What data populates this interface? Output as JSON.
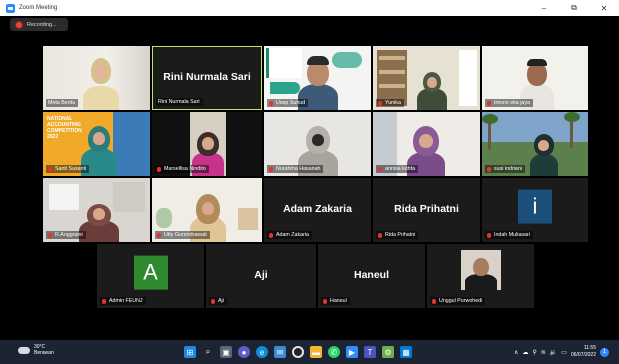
{
  "window": {
    "title": "Zoom Meeting",
    "minimize": "–",
    "restore": "⧉",
    "close": "✕"
  },
  "recording": {
    "label": "Recording..."
  },
  "participants": [
    {
      "name": "Meta Berdu",
      "video": true
    },
    {
      "name": "Rini Nurmala Sari",
      "video": false,
      "active": true
    },
    {
      "name": "Usep Suhud",
      "video": true,
      "muted": true
    },
    {
      "name": "Yunika",
      "video": true,
      "muted": true
    },
    {
      "name": "tresno eka jaya",
      "video": true,
      "muted": true
    },
    {
      "name": "Santi Susanti",
      "video": true,
      "muted": true,
      "slide_text": "NATIONAL ACCOUNTING COMPETITION 2022"
    },
    {
      "name": "Marsellisa Nindito",
      "video": true,
      "muted": true
    },
    {
      "name": "Nurahma Hasanah",
      "video": true,
      "muted": true
    },
    {
      "name": "annisa luthfa",
      "video": true,
      "muted": true
    },
    {
      "name": "susi indriani",
      "video": true,
      "muted": true
    },
    {
      "name": "R.Anggraini",
      "video": true,
      "muted": true
    },
    {
      "name": "Utty Gurendrawati",
      "video": true,
      "muted": true
    },
    {
      "name": "Adam Zakaria",
      "video": false,
      "muted": true
    },
    {
      "name": "Rida Prihatni",
      "video": false,
      "muted": true
    },
    {
      "name": "Indah Muliasari",
      "video": false,
      "muted": true,
      "avatar_letter": "i"
    },
    {
      "name": "Admin FEUNJ",
      "video": false,
      "muted": true,
      "avatar_letter": "A"
    },
    {
      "name": "Aji",
      "video": false,
      "muted": true
    },
    {
      "name": "Haneul",
      "video": false,
      "muted": true
    },
    {
      "name": "Unggul Purwohedi",
      "video": true,
      "muted": true
    }
  ],
  "taskbar": {
    "weather_temp": "30°C",
    "weather_desc": "Berawan",
    "time": "11:55",
    "date": "06/07/2022",
    "notification_count": "1"
  },
  "colors": {
    "accent": "#2d8cff",
    "active_border": "#c7e063",
    "mic_muted": "#e0352b",
    "admin_avatar": "#2f8a2f",
    "indah_avatar": "#1c4f7a"
  }
}
